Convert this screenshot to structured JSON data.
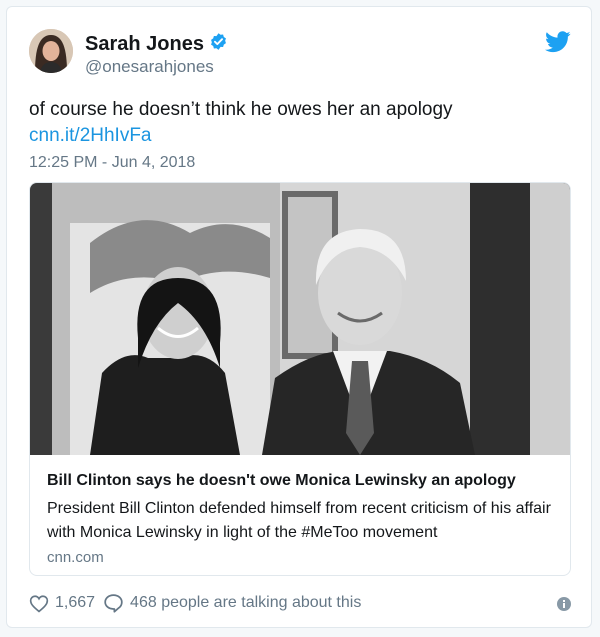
{
  "user": {
    "name": "Sarah Jones",
    "handle": "@onesarahjones"
  },
  "tweet": {
    "text": "of course he doesn’t think he owes her an apology",
    "link": "cnn.it/2HhIvFa",
    "timestamp": "12:25 PM - Jun 4, 2018"
  },
  "card": {
    "title": "Bill Clinton says he doesn't owe Monica Lewinsky an apology",
    "description": "President Bill Clinton defended himself from recent criticism of his affair with Monica Lewinsky in light of the #MeToo movement",
    "domain": "cnn.com"
  },
  "actions": {
    "likes": "1,667",
    "talking": "468 people are talking about this"
  },
  "icons": {
    "verified": "verified-badge-icon",
    "brand": "twitter-bird-icon",
    "like": "heart-icon",
    "reply": "speech-bubble-icon",
    "info": "info-icon"
  },
  "colors": {
    "accent": "#1b95e0",
    "muted": "#657786",
    "text": "#14171a"
  }
}
